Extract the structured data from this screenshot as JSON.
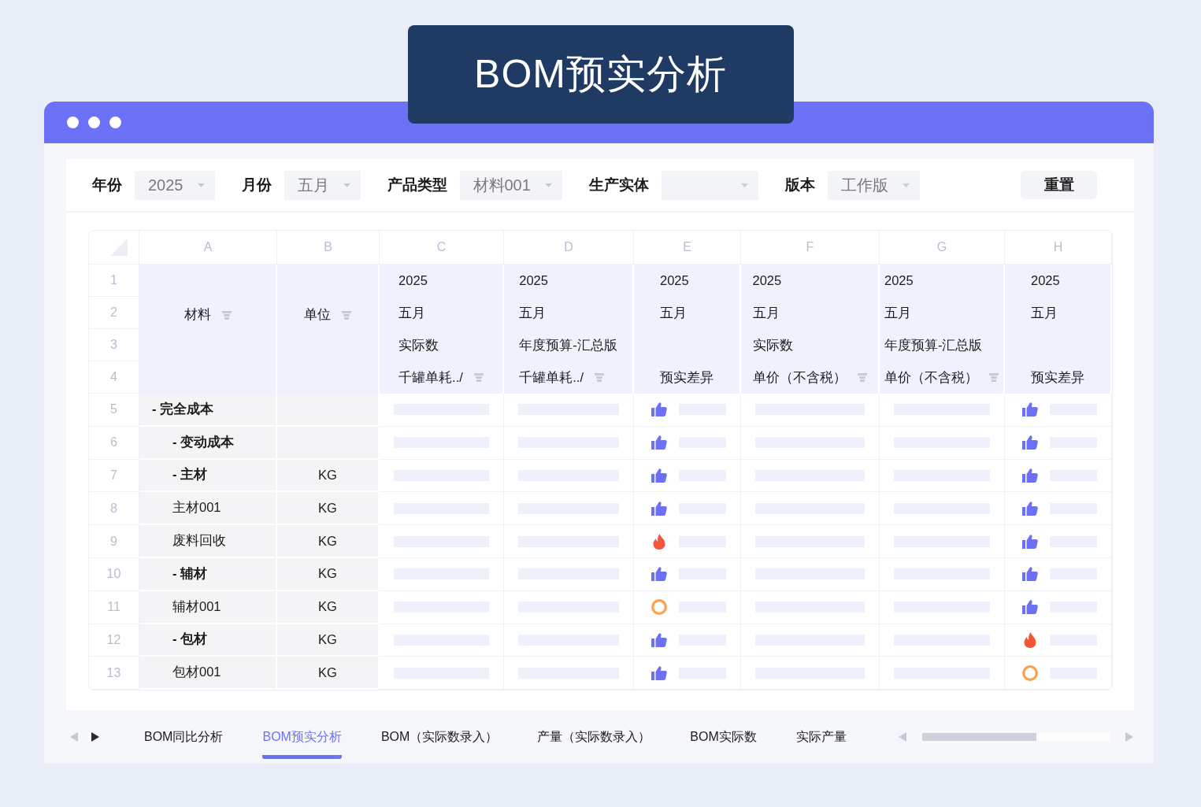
{
  "title_banner": {
    "text": "BOM预实分析"
  },
  "filters": {
    "fields": [
      {
        "label": "年份",
        "value": "2025"
      },
      {
        "label": "月份",
        "value": "五月"
      },
      {
        "label": "产品类型",
        "value": "材料001"
      },
      {
        "label": "生产实体"
      },
      {
        "label": "版本",
        "value": "工作版"
      }
    ],
    "reset_button": "重置"
  },
  "table": {
    "columns": [
      {
        "letter": "A",
        "kind": "material",
        "title": "材料",
        "filter": true
      },
      {
        "letter": "B",
        "kind": "unit",
        "title": "单位",
        "filter": true
      },
      {
        "letter": "C",
        "kind": "value",
        "year": "2025",
        "month": "五月",
        "version": "实际数",
        "measure": "千罐单耗../",
        "filter": true
      },
      {
        "letter": "D",
        "kind": "value",
        "year": "2025",
        "month": "五月",
        "version": "年度预算-汇总版",
        "measure": "千罐单耗../",
        "filter": true
      },
      {
        "letter": "E",
        "kind": "variance",
        "year": "2025",
        "month": "五月",
        "measure": "预实差异",
        "filter": false
      },
      {
        "letter": "F",
        "kind": "value",
        "year": "2025",
        "month": "五月",
        "version": "实际数",
        "measure": "单价（不含税）",
        "filter": true
      },
      {
        "letter": "G",
        "kind": "value",
        "year": "2025",
        "month": "五月",
        "version": "年度预算-汇总版",
        "measure": "单价（不含税）",
        "filter": true
      },
      {
        "letter": "H",
        "kind": "variance",
        "year": "2025",
        "month": "五月",
        "measure": "预实差异",
        "filter": false
      }
    ],
    "header_row_numbers": [
      "1",
      "2",
      "3",
      "4"
    ],
    "rows": [
      {
        "number": "5",
        "material": "- 完全成本",
        "kind": "group",
        "variance": [
          {
            "kind": "good"
          },
          {
            "kind": "good"
          }
        ],
        "children": [
          {
            "number": "6",
            "material": "- 变动成本",
            "kind": "group",
            "variance": [
              {
                "kind": "good"
              },
              {
                "kind": "good"
              }
            ]
          },
          {
            "number": "7",
            "material": "- 主材",
            "unit": "KG",
            "kind": "group",
            "variance": [
              {
                "kind": "good"
              },
              {
                "kind": "good"
              }
            ]
          },
          {
            "number": "8",
            "material": "主材001",
            "unit": "KG",
            "kind": "item",
            "variance": [
              {
                "kind": "good"
              },
              {
                "kind": "good"
              }
            ]
          },
          {
            "number": "9",
            "material": "废料回收",
            "unit": "KG",
            "kind": "item",
            "variance": [
              {
                "kind": "hot"
              },
              {
                "kind": "good"
              }
            ]
          },
          {
            "number": "10",
            "material": "- 辅材",
            "unit": "KG",
            "kind": "group",
            "variance": [
              {
                "kind": "good"
              },
              {
                "kind": "good"
              }
            ]
          },
          {
            "number": "11",
            "material": "辅材001",
            "unit": "KG",
            "kind": "item",
            "variance": [
              {
                "kind": "neutral"
              },
              {
                "kind": "good"
              }
            ]
          },
          {
            "number": "12",
            "material": "- 包材",
            "unit": "KG",
            "kind": "group",
            "variance": [
              {
                "kind": "good"
              },
              {
                "kind": "hot"
              }
            ]
          },
          {
            "number": "13",
            "material": "包材001",
            "unit": "KG",
            "kind": "item",
            "variance": [
              {
                "kind": "good"
              },
              {
                "kind": "neutral"
              }
            ]
          }
        ]
      }
    ]
  },
  "sheet_tabs": {
    "prev_disabled": true,
    "next_disabled": false,
    "tabs": [
      {
        "label": "BOM同比分析",
        "selected": false
      },
      {
        "label": "BOM预实分析",
        "selected": true
      },
      {
        "label": "BOM（实际数录入）",
        "selected": false
      },
      {
        "label": "产量（实际数录入）",
        "selected": false
      },
      {
        "label": "BOM实际数",
        "selected": false
      },
      {
        "label": "实际产量",
        "selected": false
      }
    ]
  }
}
